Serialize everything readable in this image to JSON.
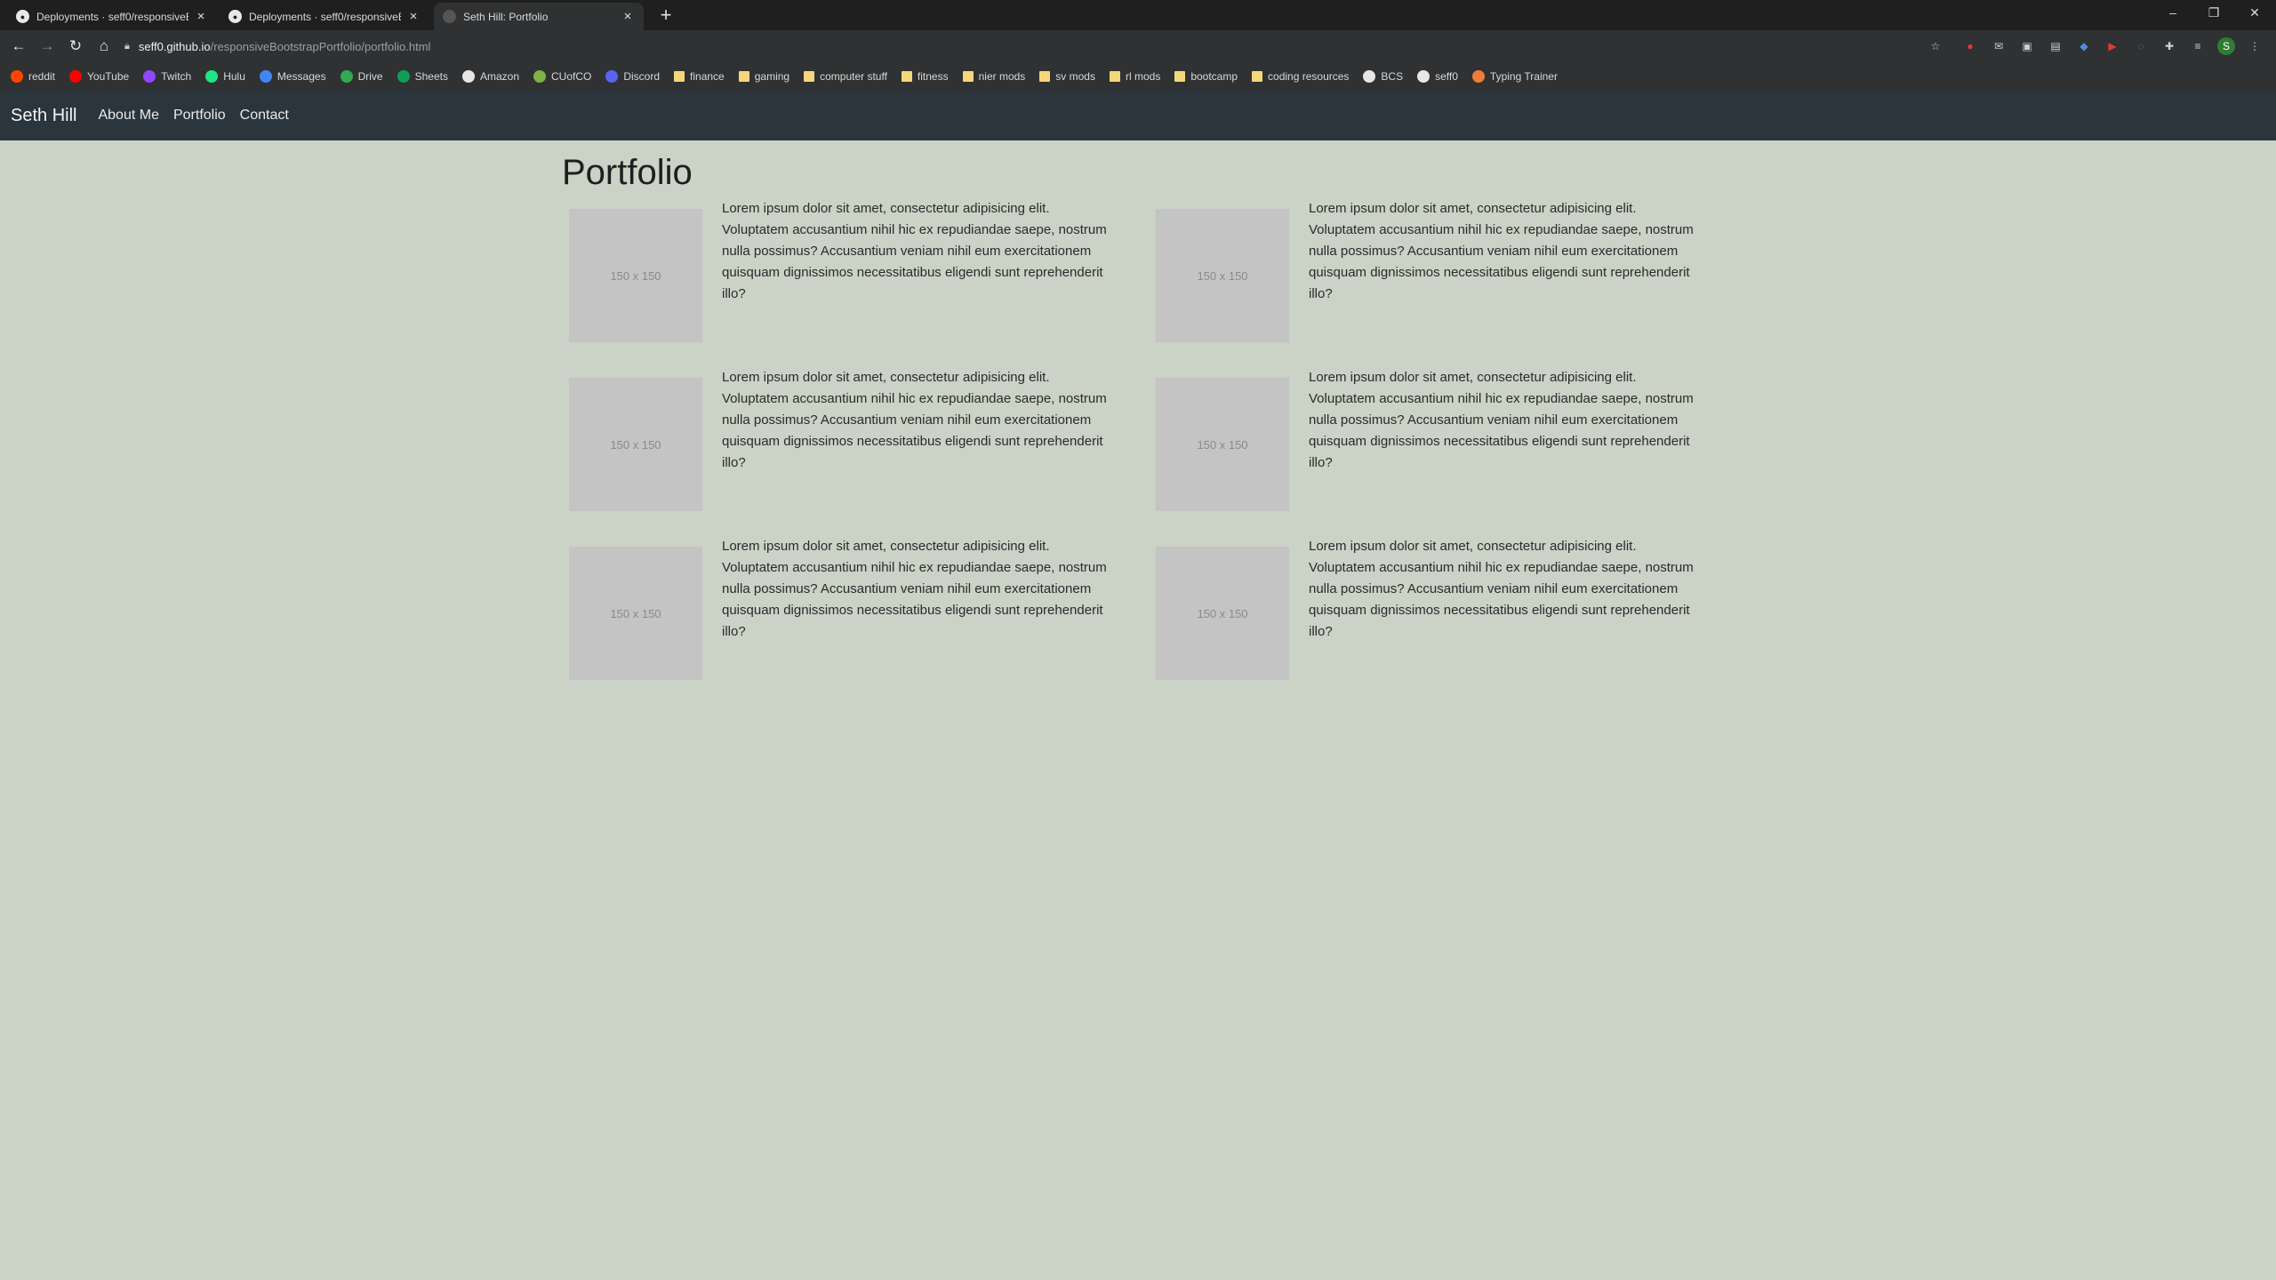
{
  "browser": {
    "tabs": [
      {
        "title": "Deployments · seff0/responsiveB"
      },
      {
        "title": "Deployments · seff0/responsiveB"
      },
      {
        "title": "Seth Hill: Portfolio"
      }
    ],
    "url_host": "seff0.github.io",
    "url_path": "/responsiveBootstrapPortfolio/portfolio.html",
    "profile_initial": "S",
    "bookmarks": [
      {
        "label": "reddit",
        "icon": "reddit-icon",
        "color": "#ff4500"
      },
      {
        "label": "YouTube",
        "icon": "youtube-icon",
        "color": "#ff0000"
      },
      {
        "label": "Twitch",
        "icon": "twitch-icon",
        "color": "#9146ff"
      },
      {
        "label": "Hulu",
        "icon": "hulu-icon",
        "color": "#1ce783"
      },
      {
        "label": "Messages",
        "icon": "messages-icon",
        "color": "#4285f4"
      },
      {
        "label": "Drive",
        "icon": "drive-icon",
        "color": "#34a853"
      },
      {
        "label": "Sheets",
        "icon": "sheets-icon",
        "color": "#0f9d58"
      },
      {
        "label": "Amazon",
        "icon": "amazon-icon",
        "color": "#e6e6e6"
      },
      {
        "label": "CUofCO",
        "icon": "cuofco-icon",
        "color": "#7cb342"
      },
      {
        "label": "Discord",
        "icon": "discord-icon",
        "color": "#5865f2"
      },
      {
        "label": "finance",
        "icon": "folder-icon",
        "color": "#f4d77a"
      },
      {
        "label": "gaming",
        "icon": "folder-icon",
        "color": "#f4d77a"
      },
      {
        "label": "computer stuff",
        "icon": "folder-icon",
        "color": "#f4d77a"
      },
      {
        "label": "fitness",
        "icon": "folder-icon",
        "color": "#f4d77a"
      },
      {
        "label": "nier mods",
        "icon": "folder-icon",
        "color": "#f4d77a"
      },
      {
        "label": "sv mods",
        "icon": "folder-icon",
        "color": "#f4d77a"
      },
      {
        "label": "rl mods",
        "icon": "folder-icon",
        "color": "#f4d77a"
      },
      {
        "label": "bootcamp",
        "icon": "folder-icon",
        "color": "#f4d77a"
      },
      {
        "label": "coding resources",
        "icon": "folder-icon",
        "color": "#f4d77a"
      },
      {
        "label": "BCS",
        "icon": "bcs-icon",
        "color": "#e6e6e6"
      },
      {
        "label": "seff0",
        "icon": "github-icon",
        "color": "#e6e6e6"
      },
      {
        "label": "Typing Trainer",
        "icon": "typing-trainer-icon",
        "color": "#ef7d3a"
      }
    ]
  },
  "site": {
    "brand": "Seth Hill",
    "nav": [
      {
        "label": "About Me"
      },
      {
        "label": "Portfolio"
      },
      {
        "label": "Contact"
      }
    ],
    "page_title": "Portfolio",
    "items": [
      {
        "thumb": "150 x 150",
        "text": "Lorem ipsum dolor sit amet, consectetur adipisicing elit. Voluptatem accusantium nihil hic ex repudiandae saepe, nostrum nulla possimus? Accusantium veniam nihil eum exercitationem quisquam dignissimos necessitatibus eligendi sunt reprehenderit illo?"
      },
      {
        "thumb": "150 x 150",
        "text": "Lorem ipsum dolor sit amet, consectetur adipisicing elit. Voluptatem accusantium nihil hic ex repudiandae saepe, nostrum nulla possimus? Accusantium veniam nihil eum exercitationem quisquam dignissimos necessitatibus eligendi sunt reprehenderit illo?"
      },
      {
        "thumb": "150 x 150",
        "text": "Lorem ipsum dolor sit amet, consectetur adipisicing elit. Voluptatem accusantium nihil hic ex repudiandae saepe, nostrum nulla possimus? Accusantium veniam nihil eum exercitationem quisquam dignissimos necessitatibus eligendi sunt reprehenderit illo?"
      },
      {
        "thumb": "150 x 150",
        "text": "Lorem ipsum dolor sit amet, consectetur adipisicing elit. Voluptatem accusantium nihil hic ex repudiandae saepe, nostrum nulla possimus? Accusantium veniam nihil eum exercitationem quisquam dignissimos necessitatibus eligendi sunt reprehenderit illo?"
      },
      {
        "thumb": "150 x 150",
        "text": "Lorem ipsum dolor sit amet, consectetur adipisicing elit. Voluptatem accusantium nihil hic ex repudiandae saepe, nostrum nulla possimus? Accusantium veniam nihil eum exercitationem quisquam dignissimos necessitatibus eligendi sunt reprehenderit illo?"
      },
      {
        "thumb": "150 x 150",
        "text": "Lorem ipsum dolor sit amet, consectetur adipisicing elit. Voluptatem accusantium nihil hic ex repudiandae saepe, nostrum nulla possimus? Accusantium veniam nihil eum exercitationem quisquam dignissimos necessitatibus eligendi sunt reprehenderit illo?"
      }
    ]
  }
}
